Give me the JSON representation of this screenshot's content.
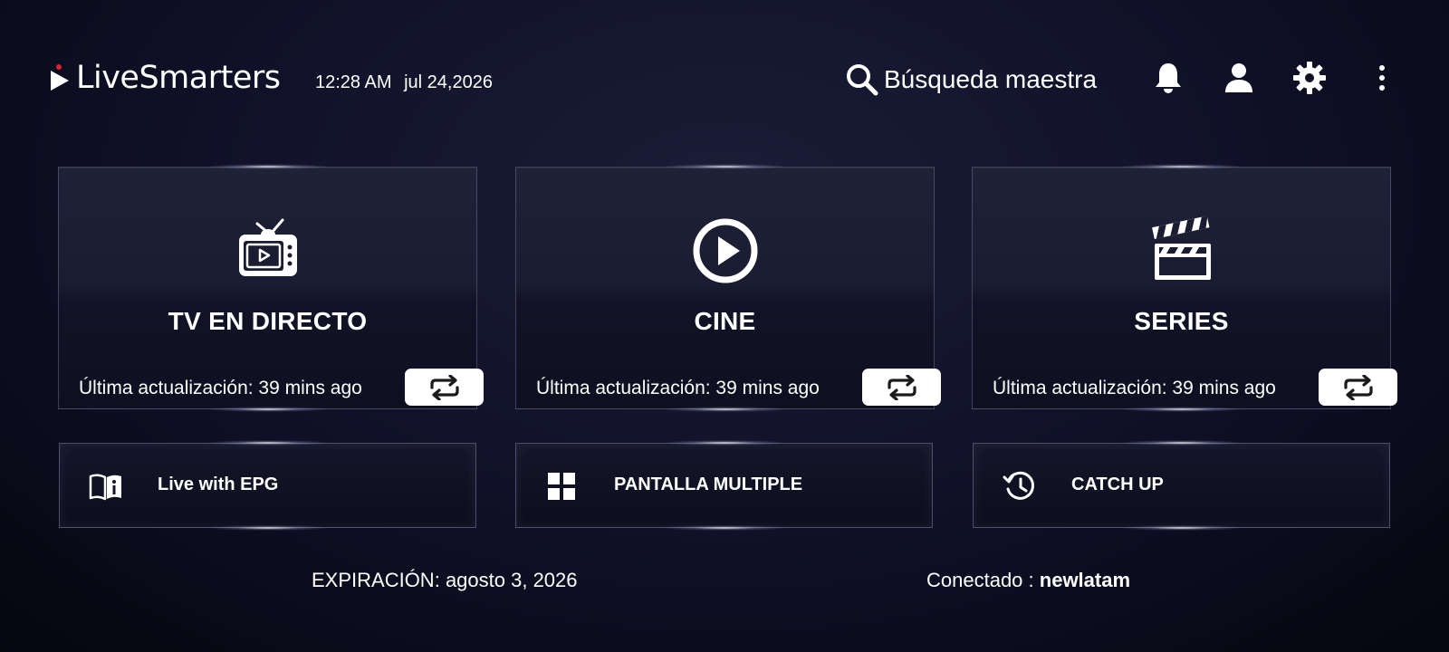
{
  "app": {
    "logo_text": "LiveSmarters",
    "time": "12:28 AM",
    "date": "jul 24,2026"
  },
  "header": {
    "search_label": "Búsqueda maestra",
    "icons": [
      "search-icon",
      "bell-icon",
      "user-icon",
      "gear-icon",
      "more-vertical-icon"
    ]
  },
  "cards": [
    {
      "title": "TV EN DIRECTO",
      "icon": "tv-icon",
      "update_text": "Última actualización: 39 mins ago"
    },
    {
      "title": "CINE",
      "icon": "play-circle-icon",
      "update_text": "Última actualización: 39 mins ago"
    },
    {
      "title": "SERIES",
      "icon": "clapperboard-icon",
      "update_text": "Última actualización: 39 mins ago"
    }
  ],
  "small_cards": [
    {
      "label": "Live with EPG",
      "icon": "book-info-icon"
    },
    {
      "label": "PANTALLA MULTIPLE",
      "icon": "grid-icon"
    },
    {
      "label": "CATCH UP",
      "icon": "history-icon"
    }
  ],
  "footer": {
    "expiration_label": "EXPIRACIÓN:",
    "expiration_date": "agosto 3, 2026",
    "connected_label": "Conectado :",
    "connected_user": "newlatam"
  },
  "colors": {
    "background": "#0f1026",
    "card": "#1a1c31",
    "accent_red": "#e0202e",
    "text": "#ffffff"
  }
}
